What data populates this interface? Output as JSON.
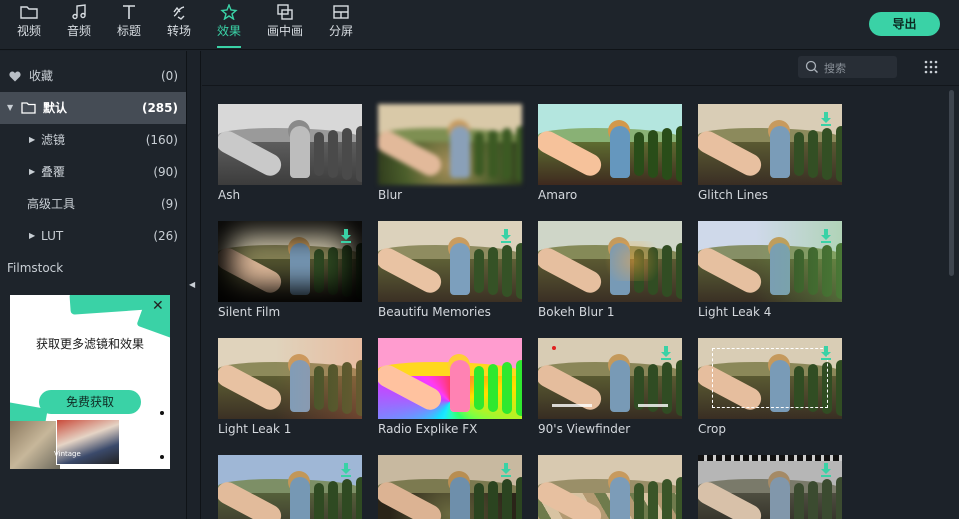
{
  "toolbar": {
    "tabs": [
      {
        "label": "视频",
        "icon": "folder-icon"
      },
      {
        "label": "音频",
        "icon": "music-note-icon"
      },
      {
        "label": "标题",
        "icon": "text-t-icon"
      },
      {
        "label": "转场",
        "icon": "transition-icon"
      },
      {
        "label": "效果",
        "icon": "effects-icon"
      },
      {
        "label": "画中画",
        "icon": "pip-icon"
      },
      {
        "label": "分屏",
        "icon": "split-screen-icon"
      }
    ],
    "active_tab": "效果",
    "export_label": "导出",
    "accent_color": "#3ad2a6"
  },
  "sidebar": {
    "items": [
      {
        "label": "收藏",
        "count": "(0)",
        "icon": "heart-icon"
      },
      {
        "label": "默认",
        "count": "(285)",
        "icon": "folder-icon",
        "expanded": true,
        "selected": true
      },
      {
        "label": "滤镜",
        "count": "(160)"
      },
      {
        "label": "叠覆",
        "count": "(90)"
      },
      {
        "label": "高级工具",
        "count": "(9)"
      },
      {
        "label": "LUT",
        "count": "(26)"
      }
    ],
    "section_label": "Filmstock"
  },
  "promo": {
    "title": "获取更多滤镜和效果",
    "button_label": "免费获取",
    "tag": "Vintage"
  },
  "search": {
    "placeholder": "搜索"
  },
  "effects": [
    {
      "name": "Ash",
      "download": false
    },
    {
      "name": "Blur",
      "download": false
    },
    {
      "name": "Amaro",
      "download": false
    },
    {
      "name": "Glitch Lines",
      "download": true
    },
    {
      "name": "Silent Film",
      "download": true
    },
    {
      "name": "Beautifu Memories",
      "download": true
    },
    {
      "name": "Bokeh Blur 1",
      "download": false
    },
    {
      "name": "Light Leak 4",
      "download": true
    },
    {
      "name": "Light Leak 1",
      "download": false
    },
    {
      "name": "Radio Explike FX",
      "download": false
    },
    {
      "name": "90's Viewfinder",
      "download": true
    },
    {
      "name": "Crop",
      "download": true
    },
    {
      "name": "",
      "download": true
    },
    {
      "name": "",
      "download": true
    },
    {
      "name": "",
      "download": false
    },
    {
      "name": "",
      "download": true
    }
  ]
}
